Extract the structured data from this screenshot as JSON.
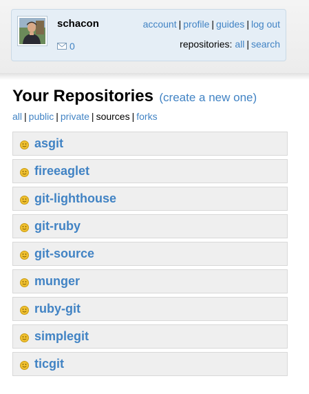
{
  "user": {
    "username": "schacon",
    "mail_count": "0",
    "links": [
      "account",
      "profile",
      "guides",
      "log out"
    ],
    "repositories_label": "repositories:",
    "repositories_links": [
      "all",
      "search"
    ]
  },
  "page": {
    "title": "Your Repositories",
    "create_link": "(create a new one)"
  },
  "filters": [
    "all",
    "public",
    "private",
    "sources",
    "forks"
  ],
  "active_filter": "sources",
  "repositories": [
    "asgit",
    "fireeaglet",
    "git-lighthouse",
    "git-ruby",
    "git-source",
    "munger",
    "ruby-git",
    "simplegit",
    "ticgit"
  ],
  "colors": {
    "link": "#4183c4",
    "userbox_bg": "#e5eef6",
    "repo_bg": "#efefef",
    "repo_icon": "#f0c030"
  },
  "icons": {
    "mail": "envelope-icon",
    "repo": "public-repo-smiley-icon"
  }
}
